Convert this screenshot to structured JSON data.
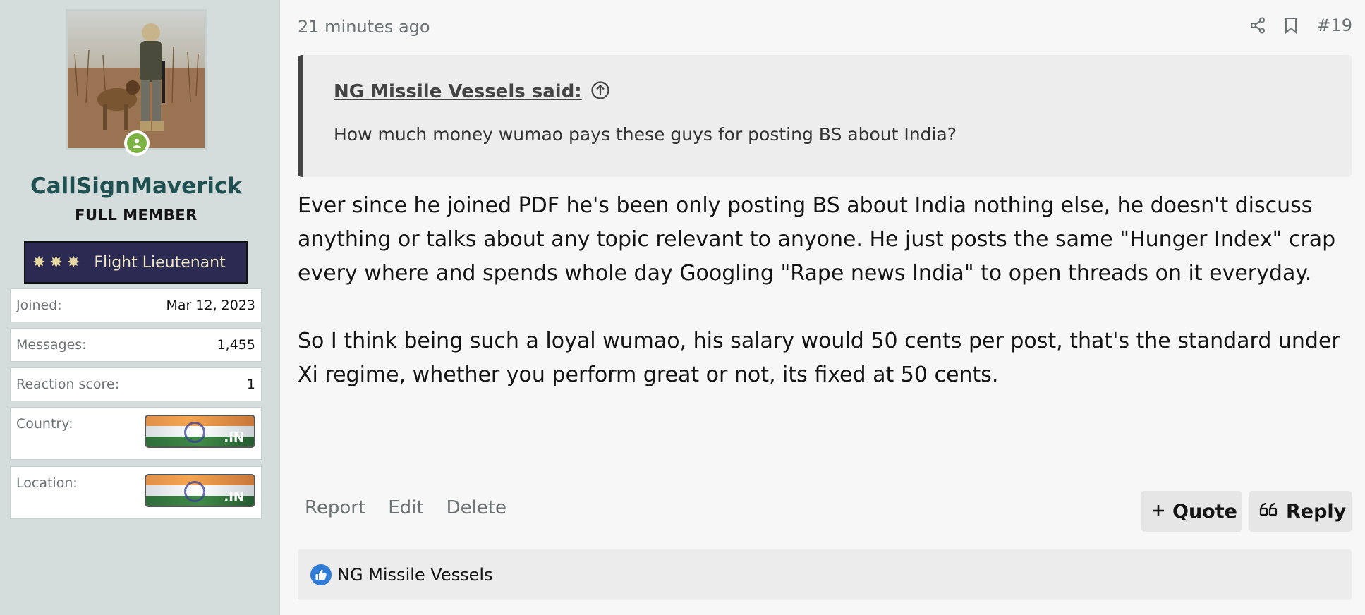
{
  "user": {
    "name": "CallSignMaverick",
    "title": "FULL MEMBER",
    "rank_banner": "Flight Lieutenant",
    "stats": [
      {
        "key": "Joined:",
        "value": "Mar 12, 2023"
      },
      {
        "key": "Messages:",
        "value": "1,455"
      },
      {
        "key": "Reaction score:",
        "value": "1"
      },
      {
        "key": "Country:",
        "value": ".IN"
      },
      {
        "key": "Location:",
        "value": ".IN"
      }
    ]
  },
  "post": {
    "time": "21 minutes ago",
    "number": "#19",
    "quote": {
      "author": "NG Missile Vessels said:",
      "text": "How much money wumao pays these guys for posting BS about India?"
    },
    "paragraphs": [
      "Ever since he joined PDF he's been only posting BS about India nothing else, he doesn't discuss anything or talks about any topic relevant to anyone. He just posts the same \"Hunger Index\" crap every where and spends whole day Googling \"Rape news India\" to open threads on it everyday.",
      "So I think being such a loyal wumao, his salary would 50 cents per post, that's the standard under Xi regime, whether you perform great or not, its fixed at 50 cents."
    ],
    "actions": {
      "report": "Report",
      "edit": "Edit",
      "delete": "Delete",
      "quote": "Quote",
      "reply": "Reply"
    },
    "reactions": {
      "user": "NG Missile Vessels"
    }
  },
  "colors": {
    "accent": "#1f5052",
    "online": "#7cb342",
    "like": "#2f7bd6",
    "rank_bg": "#2b2a52"
  }
}
